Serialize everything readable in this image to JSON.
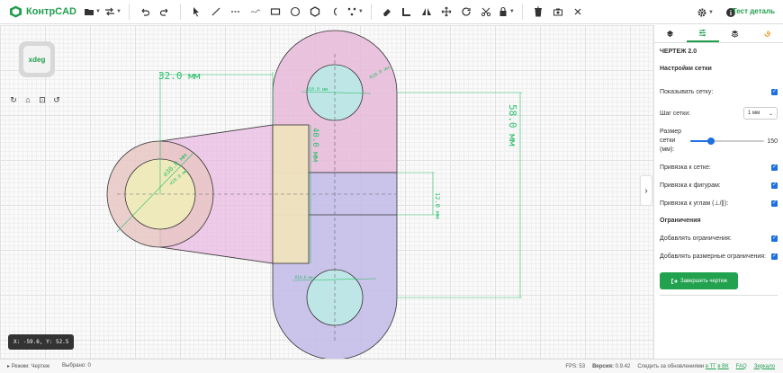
{
  "app": {
    "name": "КонтрCAD",
    "user_label": "Тест деталь"
  },
  "colors": {
    "accent": "#1f9e4c",
    "checkbox": "#1e6fe0",
    "dimension": "#2bbf6b"
  },
  "toolbar": {
    "icons": [
      "folder-icon",
      "swap-icon",
      "undo-icon",
      "redo-icon",
      "pointer-icon",
      "line-icon",
      "dashed-line-icon",
      "spline-icon",
      "rectangle-icon",
      "circle-icon",
      "polygon-icon",
      "arc-icon",
      "points-icon",
      "eraser-icon",
      "fillet-icon",
      "mirror-icon",
      "move-icon",
      "rotate-icon",
      "trim-icon",
      "lock-icon",
      "delete-icon",
      "camera-icon",
      "close-icon",
      "settings-icon",
      "info-icon"
    ]
  },
  "canvas": {
    "viewcube_label": "xdeg",
    "coords": "X: -59.6, Y: 52.5",
    "dimensions": {
      "d32": "32.0 мм",
      "d58": "58.0 мм",
      "d40": "40.0 мм",
      "d12": "12.0 мм",
      "r_top_left": "⌀10.0 мм",
      "r_top_right": "R10.0 мм",
      "d_big_circle": "⌀30.0 мм",
      "d_small_circle": "⌀20.0 мм",
      "r_bottom": "R10.0 мм"
    }
  },
  "panel": {
    "tabs": [
      "layers-icon",
      "sliders-icon",
      "stack-icon",
      "history-icon"
    ],
    "title": "ЧЕРТЕЖ 2.0",
    "grid_section": "Настройки сетки",
    "show_grid": "Показывать сетку:",
    "grid_step": "Шаг сетки:",
    "grid_step_value": "1 мм",
    "grid_size": "Размер сетки (мм):",
    "grid_size_value": "150",
    "grid_size_fraction": 0.27,
    "snap_grid": "Привязка к сетке:",
    "snap_shapes": "Привязка к фигурам:",
    "snap_angles": "Привязка к углам (⊥/∥):",
    "constraints_section": "Ограничения",
    "add_constraints": "Добавлять ограничения:",
    "add_dim_constraints": "Добавлять размерные ограничения:",
    "finish_button": "Завершить чертеж"
  },
  "status": {
    "mode": "Режим: Чертеж",
    "selected": "Выбрано: 0",
    "fps": "FPS: 53",
    "version_label": "Версия:",
    "version": "0.9.42",
    "follow": "Следить за обновлениями",
    "tg": "в ТГ",
    "vk": "в ВК",
    "faq": "FAQ",
    "mirror": "Зеркало"
  }
}
